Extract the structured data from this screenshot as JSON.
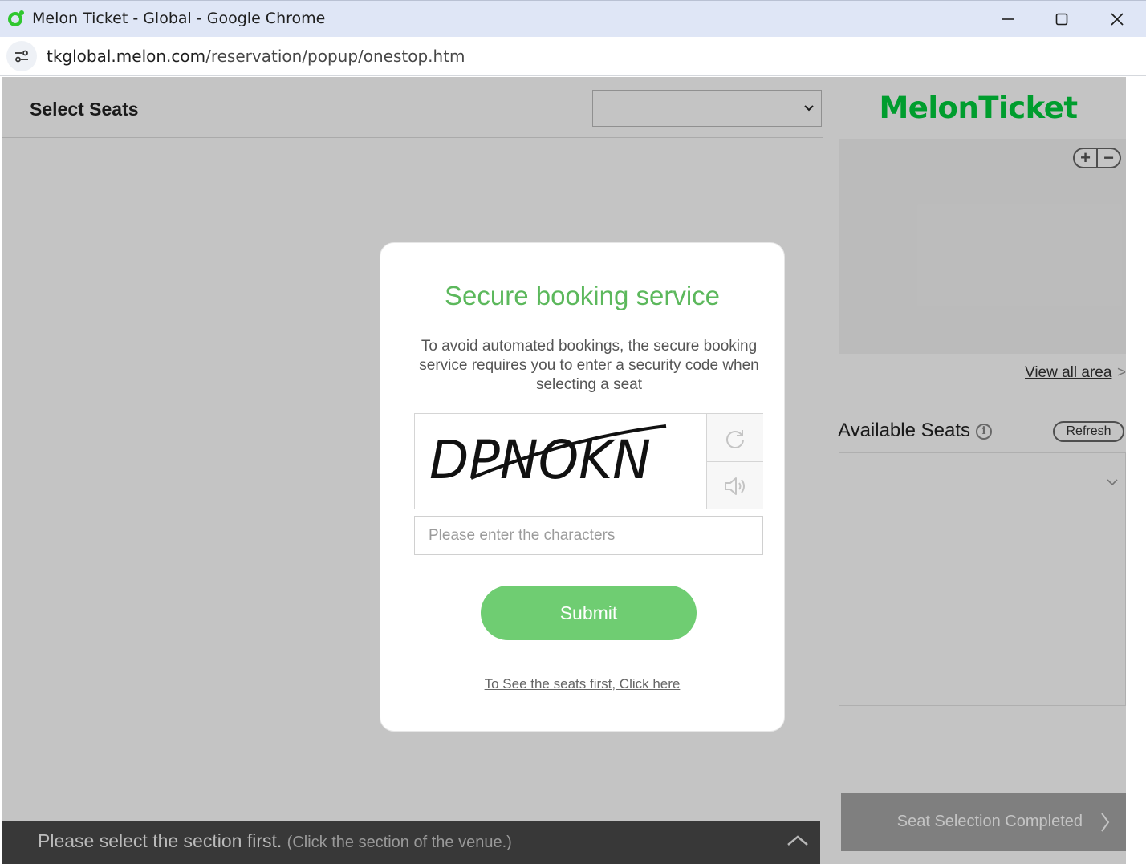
{
  "window": {
    "title": "Melon Ticket - Global - Google Chrome",
    "url_domain": "tkglobal.melon.com",
    "url_path": "/reservation/popup/onestop.htm"
  },
  "left_panel": {
    "title": "Select Seats",
    "select_value": "",
    "bottom_message": "Please select the section first.",
    "bottom_hint": "(Click the section of the venue.)"
  },
  "right_panel": {
    "brand": "MelonTicket",
    "zoom_in": "+",
    "zoom_out": "−",
    "view_all": "View all area",
    "view_all_arrow": ">",
    "available_seats_title": "Available Seats",
    "info_glyph": "i",
    "refresh_label": "Refresh",
    "complete_label": "Seat Selection Completed",
    "complete_arrow": "〉"
  },
  "modal": {
    "title": "Secure booking service",
    "description": "To avoid automated bookings, the secure booking service requires you to enter a security code when selecting a seat",
    "captcha_text": "DPNOKN",
    "input_placeholder": "Please enter the characters",
    "input_value": "",
    "submit_label": "Submit",
    "see_seats_link": "To See the seats first, Click here"
  },
  "icons": {
    "refresh_captcha": "refresh-icon",
    "audio_captcha": "speaker-icon",
    "site_info": "tune-icon"
  },
  "colors": {
    "brand_green": "#00cd3c",
    "modal_title_green": "#5cb85c",
    "submit_green": "#6fcd72",
    "bottom_bar": "#4a4a4a"
  }
}
